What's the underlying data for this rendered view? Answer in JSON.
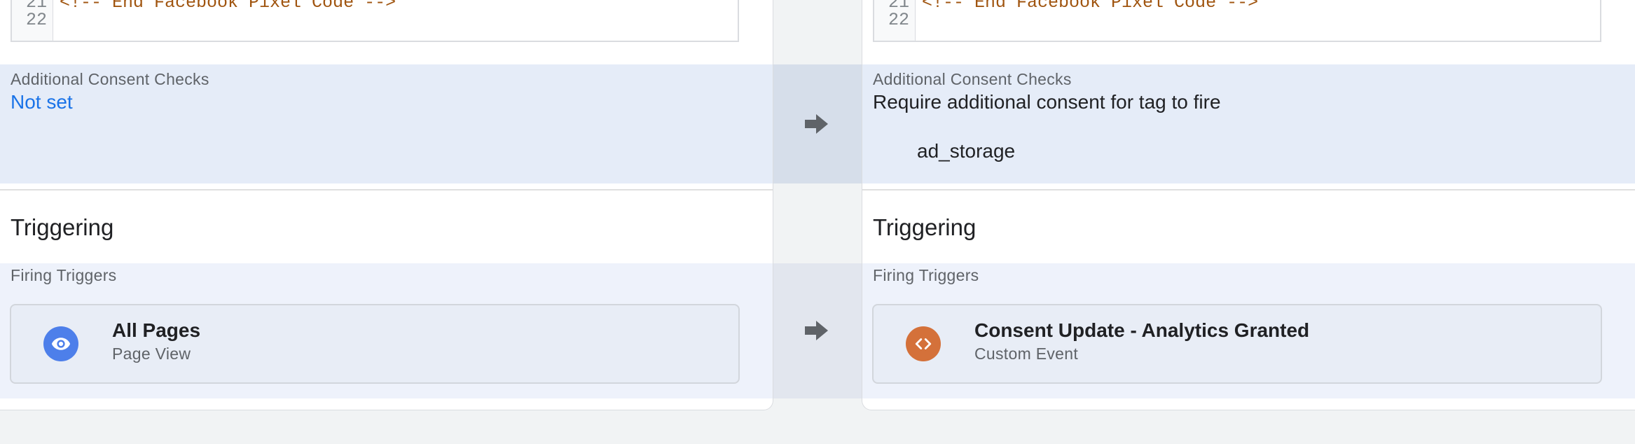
{
  "left": {
    "code": {
      "lines": [
        {
          "number": "21",
          "text": "<!-- End Facebook Pixel Code -->"
        },
        {
          "number": "22",
          "text": ""
        }
      ]
    },
    "consent": {
      "label": "Additional Consent Checks",
      "value": "Not set"
    },
    "triggering": {
      "title": "Triggering",
      "firing_label": "Firing Triggers",
      "trigger": {
        "name": "All Pages",
        "type": "Page View",
        "icon": "eye-icon",
        "icon_color": "#4d7fea"
      }
    }
  },
  "right": {
    "code": {
      "lines": [
        {
          "number": "21",
          "text": "<!-- End Facebook Pixel Code -->"
        },
        {
          "number": "22",
          "text": ""
        }
      ]
    },
    "consent": {
      "label": "Additional Consent Checks",
      "value": "Require additional consent for tag to fire",
      "item": "ad_storage"
    },
    "triggering": {
      "title": "Triggering",
      "firing_label": "Firing Triggers",
      "trigger": {
        "name": "Consent Update - Analytics Granted",
        "type": "Custom Event",
        "icon": "code-icon",
        "icon_color": "#d4713a"
      }
    }
  },
  "compare": {
    "arrow_icon": "arrow-right-icon",
    "arrow_color": "#5f6368"
  }
}
